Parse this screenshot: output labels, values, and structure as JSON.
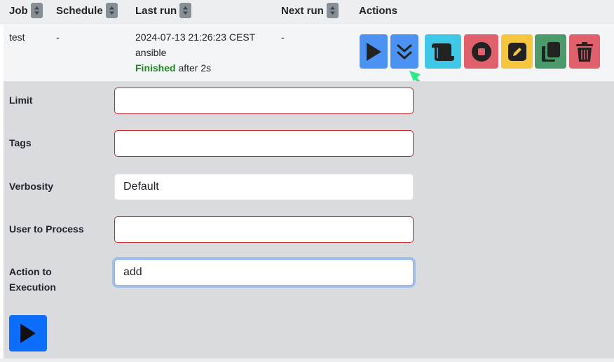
{
  "table": {
    "headers": {
      "job": "Job",
      "schedule": "Schedule",
      "last_run": "Last run",
      "next_run": "Next run",
      "actions": "Actions"
    }
  },
  "job_row": {
    "job": "test",
    "schedule": "-",
    "last_run_time": "2024-07-13 21:26:23 CEST",
    "last_run_user": "ansible",
    "status": "Finished",
    "duration": "after 2s",
    "next_run": "-"
  },
  "actions": {
    "buttons": [
      {
        "name": "run",
        "icon": "play-icon",
        "color": "#4b92f2"
      },
      {
        "name": "expand",
        "icon": "chevrons-down-icon",
        "color": "#4b92f2"
      },
      {
        "name": "logs",
        "icon": "scroll-icon",
        "color": "#40c8e8"
      },
      {
        "name": "stop",
        "icon": "stop-icon",
        "color": "#e0606b"
      },
      {
        "name": "edit",
        "icon": "pencil-icon",
        "color": "#f7c63f"
      },
      {
        "name": "copy",
        "icon": "copy-icon",
        "color": "#4a9a6a"
      },
      {
        "name": "delete",
        "icon": "trash-icon",
        "color": "#e0606b"
      }
    ],
    "highlight_arrow_color": "#2ee88a"
  },
  "form": {
    "limit": {
      "label": "Limit",
      "value": ""
    },
    "tags": {
      "label": "Tags",
      "value": ""
    },
    "verbosity": {
      "label": "Verbosity",
      "value": "Default"
    },
    "user_to_process": {
      "label": "User to Process",
      "value": ""
    },
    "action_to_execution": {
      "label": "Action to Execution",
      "value": "add"
    },
    "run_button_icon": "play-icon",
    "run_button_color": "#0d6efd"
  }
}
